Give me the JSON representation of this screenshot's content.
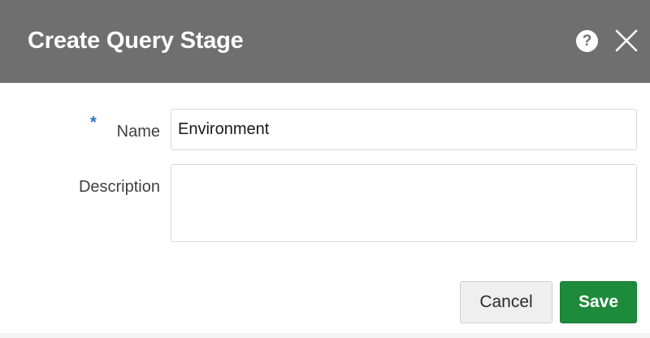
{
  "dialog": {
    "title": "Create Query Stage",
    "help_icon": "question-circle-icon",
    "help_glyph": "?",
    "close_icon": "close-x-icon"
  },
  "form": {
    "required_marker": "*",
    "name_label": "Name",
    "name_value": "Environment",
    "description_label": "Description",
    "description_value": ""
  },
  "buttons": {
    "cancel_label": "Cancel",
    "save_label": "Save"
  },
  "colors": {
    "header_bg": "#6f6f6f",
    "save_bg": "#1e8a3b",
    "required_marker": "#2b6fc0"
  }
}
